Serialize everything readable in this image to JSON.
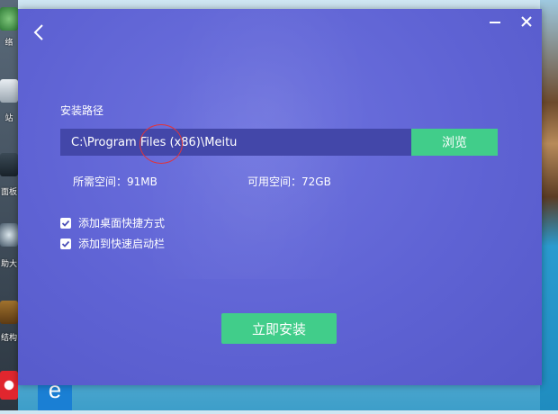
{
  "desktop": {
    "left_labels": [
      "络",
      "站",
      "面板",
      "助大",
      "结构"
    ]
  },
  "installer": {
    "title_controls": {
      "back_icon": "chevron-left-icon",
      "minimize_icon": "minimize-icon",
      "close_icon": "close-icon"
    },
    "path_label": "安装路径",
    "path_value": "C:\\Program Files (x86)\\Meitu",
    "browse_label": "浏览",
    "required_space": "所需空间：91MB",
    "available_space": "可用空间：72GB",
    "options": [
      {
        "label": "添加桌面快捷方式",
        "checked": true
      },
      {
        "label": "添加到快速启动栏",
        "checked": true
      }
    ],
    "install_label": "立即安装"
  },
  "colors": {
    "window_bg": "#5f63d4",
    "accent_green": "#41cd8a",
    "path_box_bg": "#4347a9",
    "annotation_red": "#e0343c"
  }
}
